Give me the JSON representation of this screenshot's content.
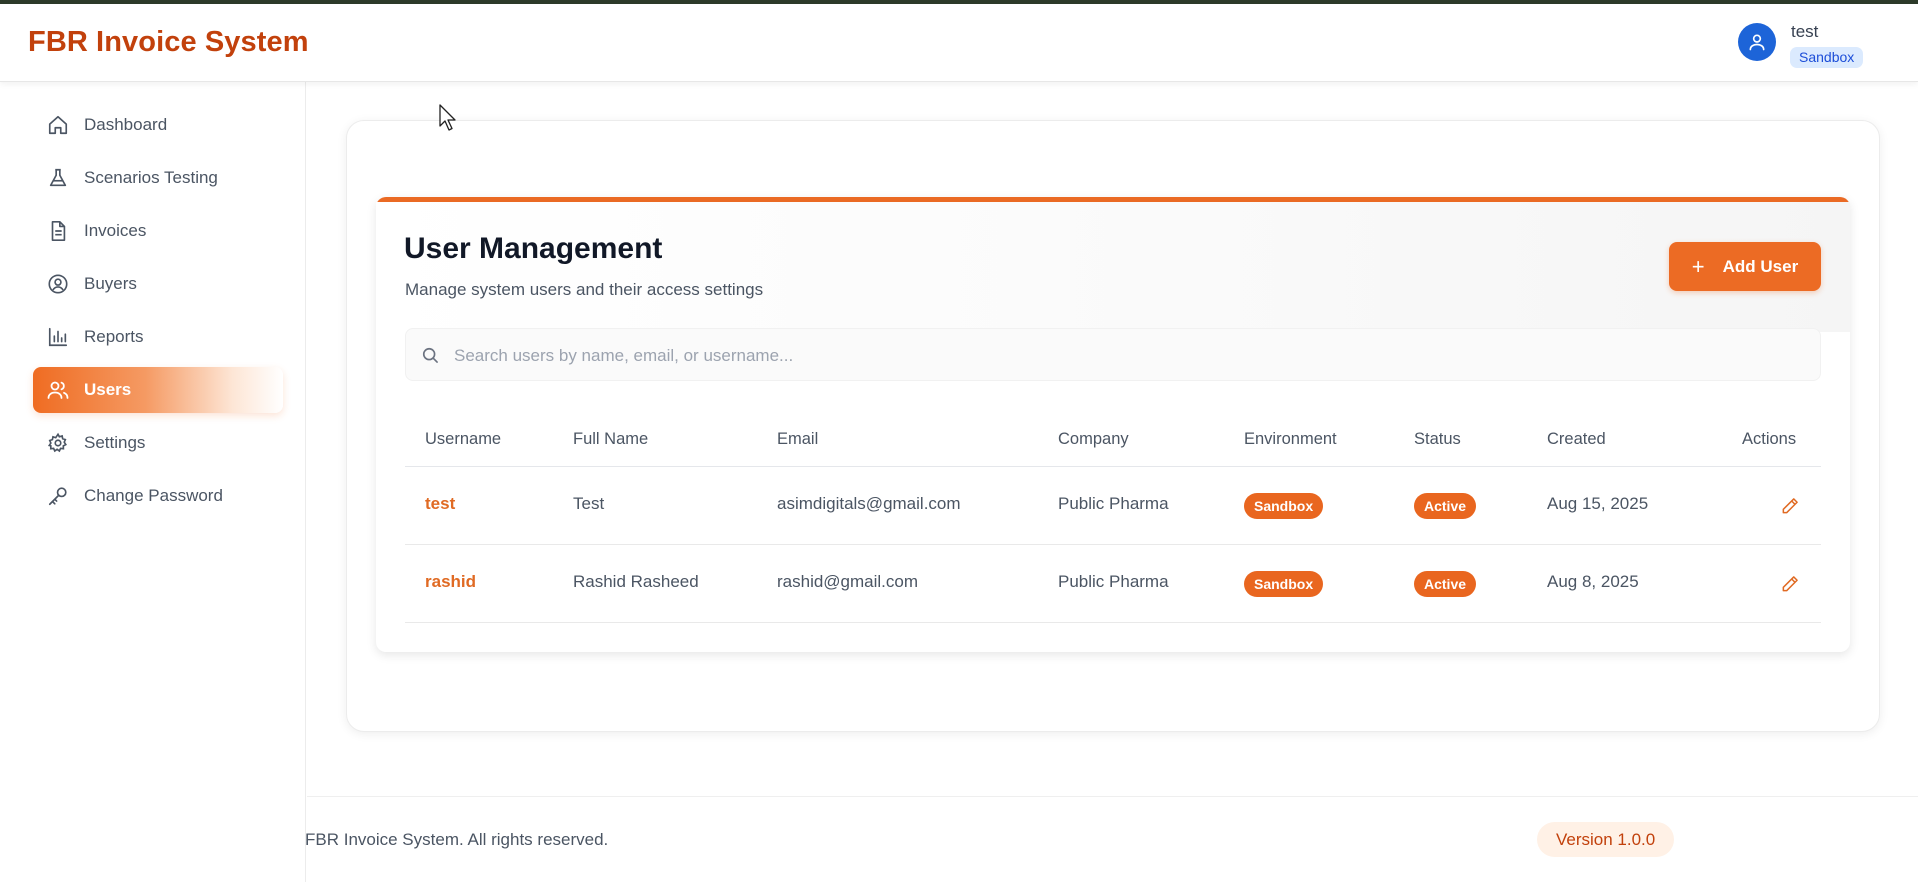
{
  "header": {
    "app_title": "FBR Invoice System",
    "user_name": "test",
    "environment": "Sandbox"
  },
  "sidebar": {
    "items": [
      {
        "label": "Dashboard",
        "icon": "home-icon",
        "active": false
      },
      {
        "label": "Scenarios Testing",
        "icon": "flask-icon",
        "active": false
      },
      {
        "label": "Invoices",
        "icon": "document-icon",
        "active": false
      },
      {
        "label": "Buyers",
        "icon": "user-circle-icon",
        "active": false
      },
      {
        "label": "Reports",
        "icon": "bar-chart-icon",
        "active": false
      },
      {
        "label": "Users",
        "icon": "users-icon",
        "active": true
      },
      {
        "label": "Settings",
        "icon": "gear-icon",
        "active": false
      },
      {
        "label": "Change Password",
        "icon": "key-icon",
        "active": false
      }
    ]
  },
  "main": {
    "title": "User Management",
    "subtitle": "Manage system users and their access settings",
    "add_button_label": "Add User",
    "search_placeholder": "Search users by name, email, or username...",
    "table": {
      "columns": [
        "Username",
        "Full Name",
        "Email",
        "Company",
        "Environment",
        "Status",
        "Created",
        "Actions"
      ],
      "rows": [
        {
          "username": "test",
          "full_name": "Test",
          "email": "asimdigitals@gmail.com",
          "company": "Public Pharma",
          "environment": "Sandbox",
          "status": "Active",
          "created": "Aug 15, 2025"
        },
        {
          "username": "rashid",
          "full_name": "Rashid Rasheed",
          "email": "rashid@gmail.com",
          "company": "Public Pharma",
          "environment": "Sandbox",
          "status": "Active",
          "created": "Aug 8, 2025"
        }
      ]
    }
  },
  "footer": {
    "copyright": "FBR Invoice System. All rights reserved.",
    "version": "Version 1.0.0"
  },
  "colors": {
    "accent": "#ec6b24",
    "title": "#c2410c",
    "avatar": "#1d64d8"
  }
}
